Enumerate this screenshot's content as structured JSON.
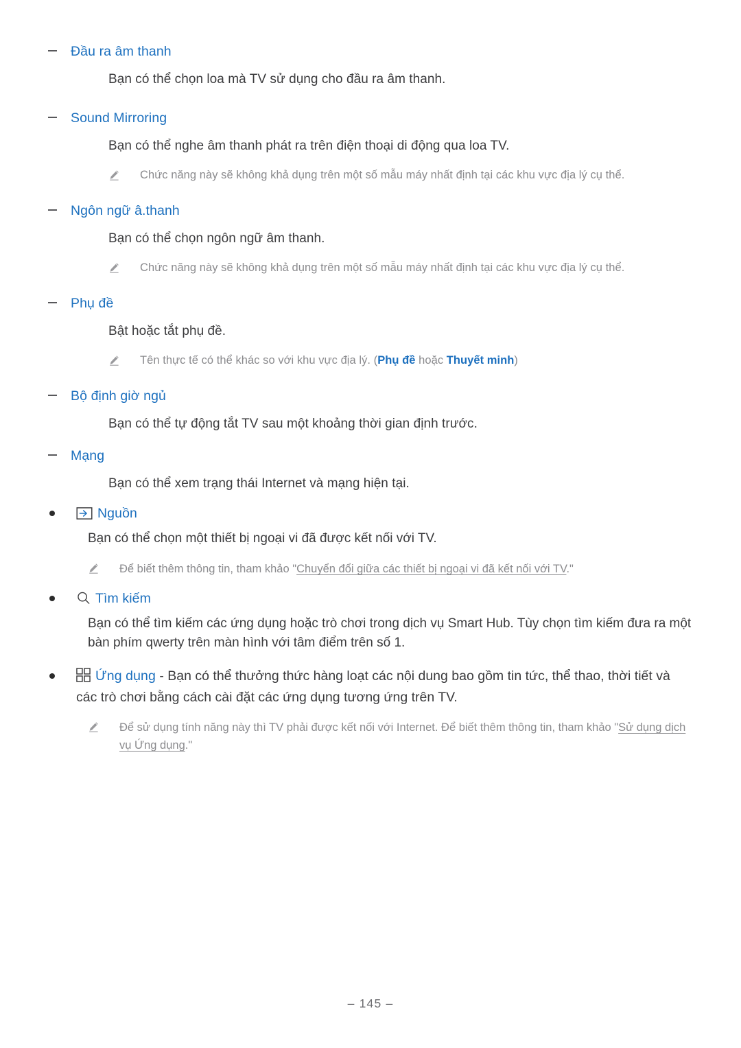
{
  "document": {
    "page_number": "– 145 –",
    "accent_blue": "#1b6fbe",
    "body_color": "#3b3b3d",
    "note_color": "#8a8a8d"
  },
  "sections": [
    {
      "heading": "Đầu ra âm thanh",
      "body": "Bạn có thể chọn loa mà TV sử dụng cho đầu ra âm thanh."
    },
    {
      "heading": "Sound Mirroring",
      "body": "Bạn có thể nghe âm thanh phát ra trên điện thoại di động qua loa TV.",
      "note": "Chức năng này sẽ không khả dụng trên một số mẫu máy nhất định tại các khu vực địa lý cụ thể."
    },
    {
      "heading": "Ngôn ngữ â.thanh",
      "body": "Bạn có thể chọn ngôn ngữ âm thanh.",
      "note": "Chức năng này sẽ không khả dụng trên một số mẫu máy nhất định tại các khu vực địa lý cụ thể."
    },
    {
      "heading": "Phụ đề",
      "body": "Bật hoặc tắt phụ đề.",
      "note_parts": {
        "prefix": "Tên thực tế có thể khác so với khu vực địa lý. (",
        "bold1": "Phụ đề",
        "middle": " hoặc ",
        "bold2": "Thuyết minh",
        "suffix": ")"
      }
    },
    {
      "heading": "Bộ định giờ ngủ",
      "body": "Bạn có thể tự động tắt TV sau một khoảng thời gian định trước."
    },
    {
      "heading": "Mạng",
      "body": "Bạn có thể xem trạng thái Internet và mạng hiện tại."
    }
  ],
  "top_items": [
    {
      "icon": "source-icon",
      "label": "Nguồn",
      "body": "Bạn có thể chọn một thiết bị ngoại vi đã được kết nối với TV.",
      "note_parts": {
        "prefix": "Để biết thêm thông tin, tham khảo \"",
        "link": "Chuyển đổi giữa các thiết bị ngoại vi đã kết nối với TV",
        "suffix": ".\""
      }
    },
    {
      "icon": "search-icon",
      "label": "Tìm kiếm",
      "body": "Bạn có thể tìm kiếm các ứng dụng hoặc trò chơi trong dịch vụ Smart Hub. Tùy chọn tìm kiếm đưa ra một bàn phím qwerty trên màn hình với tâm điểm trên số 1."
    },
    {
      "icon": "apps-grid-icon",
      "label": "Ứng dụng",
      "inline_body": " - Bạn có thể thưởng thức hàng loạt các nội dung bao gồm tin tức, thể thao, thời tiết và các trò chơi bằng cách cài đặt các ứng dụng tương ứng trên TV.",
      "note_parts": {
        "prefix": "Để sử dụng tính năng này thì TV phải được kết nối với Internet. Để biết thêm thông tin, tham khảo \"",
        "link": "Sử dụng dịch vụ Ứng dụng",
        "suffix": ".\""
      }
    }
  ]
}
